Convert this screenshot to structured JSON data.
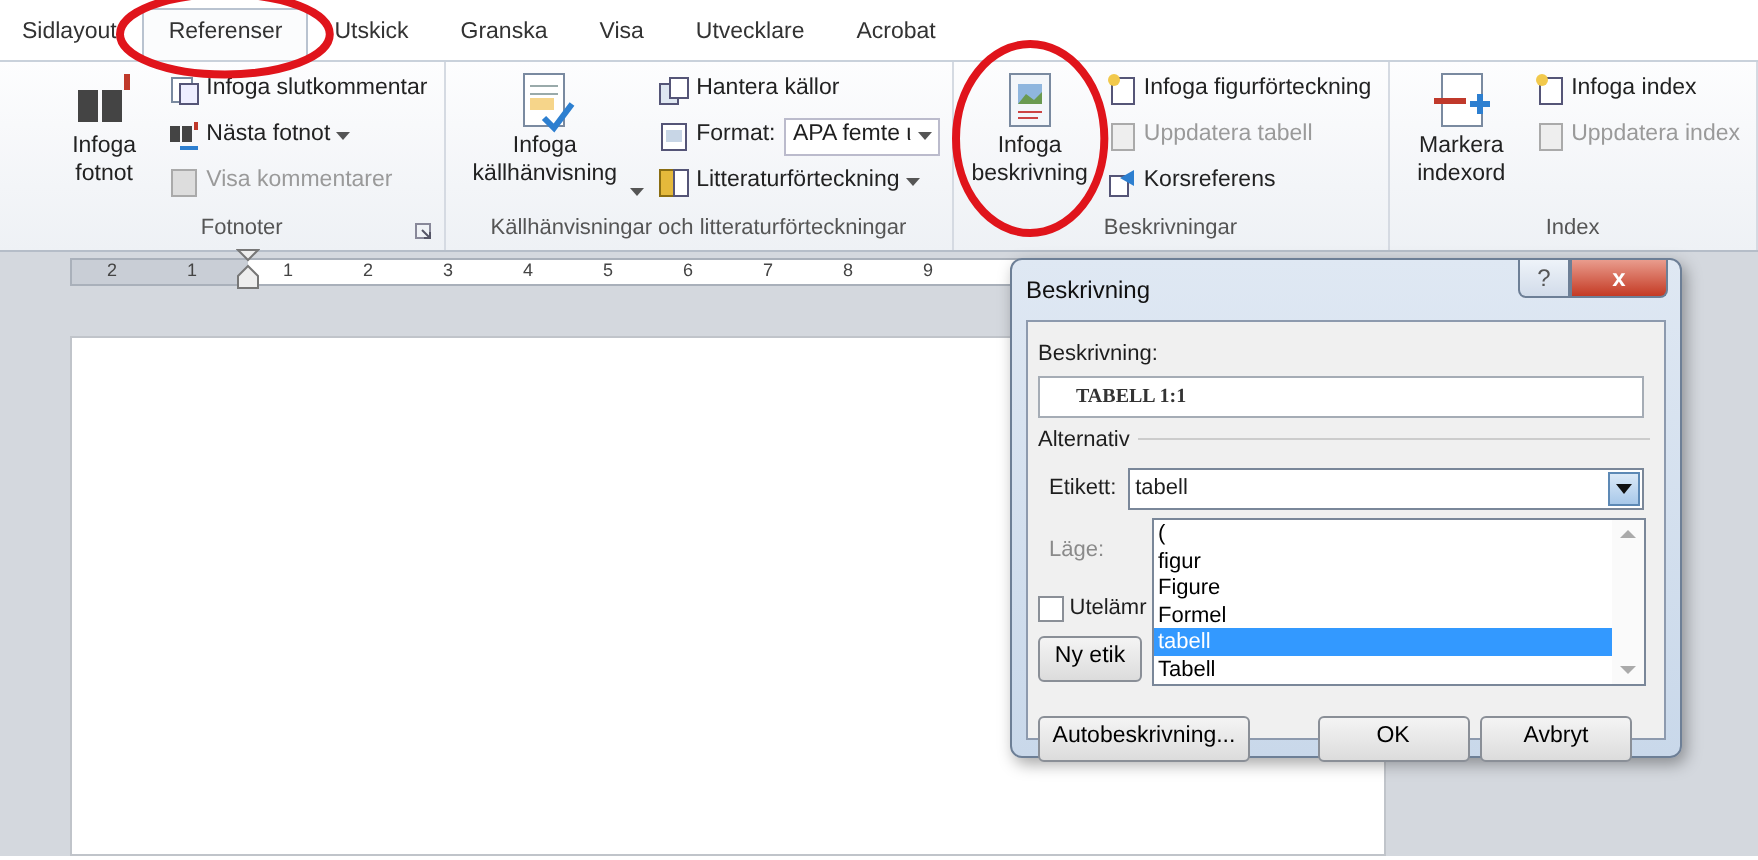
{
  "tabs": [
    {
      "label": "Sidlayout",
      "selected": false
    },
    {
      "label": "Referenser",
      "selected": true,
      "circled": true
    },
    {
      "label": "Utskick",
      "selected": false
    },
    {
      "label": "Granska",
      "selected": false
    },
    {
      "label": "Visa",
      "selected": false
    },
    {
      "label": "Utvecklare",
      "selected": false
    },
    {
      "label": "Acrobat",
      "selected": false
    }
  ],
  "ribbon_groups": [
    {
      "title": "Fotnoter",
      "launcher": true,
      "large_button": {
        "label": "Infoga fotnot"
      },
      "items": [
        {
          "label": "Infoga slutkommentar",
          "disabled": false
        },
        {
          "label": "Nästa fotnot",
          "disabled": false,
          "dropdown": true
        },
        {
          "label": "Visa kommentarer",
          "disabled": true
        }
      ]
    },
    {
      "title": "Källhänvisningar och litteraturförteckningar",
      "large_button": {
        "label": "Infoga källhänvisning",
        "dropdown": true
      },
      "items": [
        {
          "label": "Hantera källor",
          "disabled": false
        },
        {
          "label": "Format:",
          "disabled": false,
          "combo_value": "APA femte ι"
        },
        {
          "label": "Litteraturförteckning",
          "disabled": false,
          "dropdown": true
        }
      ]
    },
    {
      "title": "Beskrivningar",
      "large_button": {
        "label": "Infoga beskrivning",
        "circled": true
      },
      "items": [
        {
          "label": "Infoga figurförteckning",
          "disabled": false
        },
        {
          "label": "Uppdatera tabell",
          "disabled": true
        },
        {
          "label": "Korsreferens",
          "disabled": false
        }
      ]
    },
    {
      "title": "Index",
      "large_button": {
        "label": "Markera indexord"
      },
      "items": [
        {
          "label": "Infoga index",
          "disabled": false
        },
        {
          "label": "Uppdatera index",
          "disabled": true
        }
      ]
    }
  ],
  "ruler": {
    "labels": [
      "2",
      "1",
      "1",
      "2",
      "3",
      "4",
      "5",
      "6",
      "7",
      "8",
      "9"
    ]
  },
  "dialog": {
    "title": "Beskrivning",
    "help": "?",
    "close": "x",
    "caption_label": "Beskrivning:",
    "caption_value": "TABELL 1:1",
    "section": "Alternativ",
    "label_field": {
      "label": "Etikett:",
      "value": "tabell",
      "expanded": true
    },
    "position_label": {
      "label": "Läge:",
      "disabled": true
    },
    "checkbox": {
      "label": "Utelämr",
      "checked": false
    },
    "new_label_button": "Ny etik",
    "dropdown_options": [
      {
        "label": "(",
        "selected": false
      },
      {
        "label": "figur",
        "selected": false
      },
      {
        "label": "Figure",
        "selected": false
      },
      {
        "label": "Formel",
        "selected": false
      },
      {
        "label": "tabell",
        "selected": true
      },
      {
        "label": "Tabell",
        "selected": false
      }
    ],
    "buttons": [
      "Autobeskrivning...",
      "OK",
      "Avbryt"
    ]
  }
}
